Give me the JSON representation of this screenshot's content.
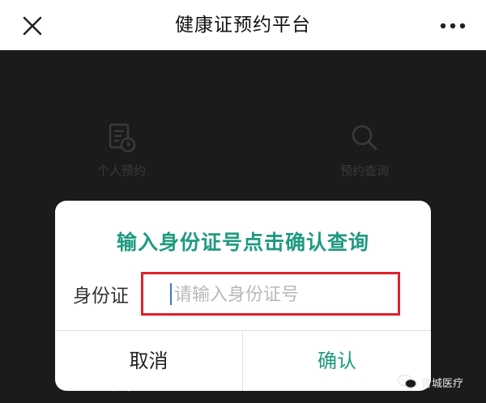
{
  "header": {
    "title": "健康证预约平台",
    "close_icon": "close-icon",
    "more_icon": "more-dots-icon"
  },
  "background": {
    "items": [
      {
        "label": "个人预约",
        "icon": "document-clock-icon"
      },
      {
        "label": "预约查询",
        "icon": "search-icon"
      }
    ]
  },
  "dialog": {
    "title": "输入身份证号点击确认查询",
    "id_label": "身份证",
    "input_value": "",
    "input_placeholder": "请输入身份证号",
    "cancel_label": "取消",
    "confirm_label": "确认"
  },
  "watermark": {
    "text": "青城医疗",
    "icon": "wechat-icon"
  },
  "colors": {
    "accent": "#1f9a80",
    "highlight_border": "#e0212b",
    "overlay": "#1b1b1b"
  }
}
